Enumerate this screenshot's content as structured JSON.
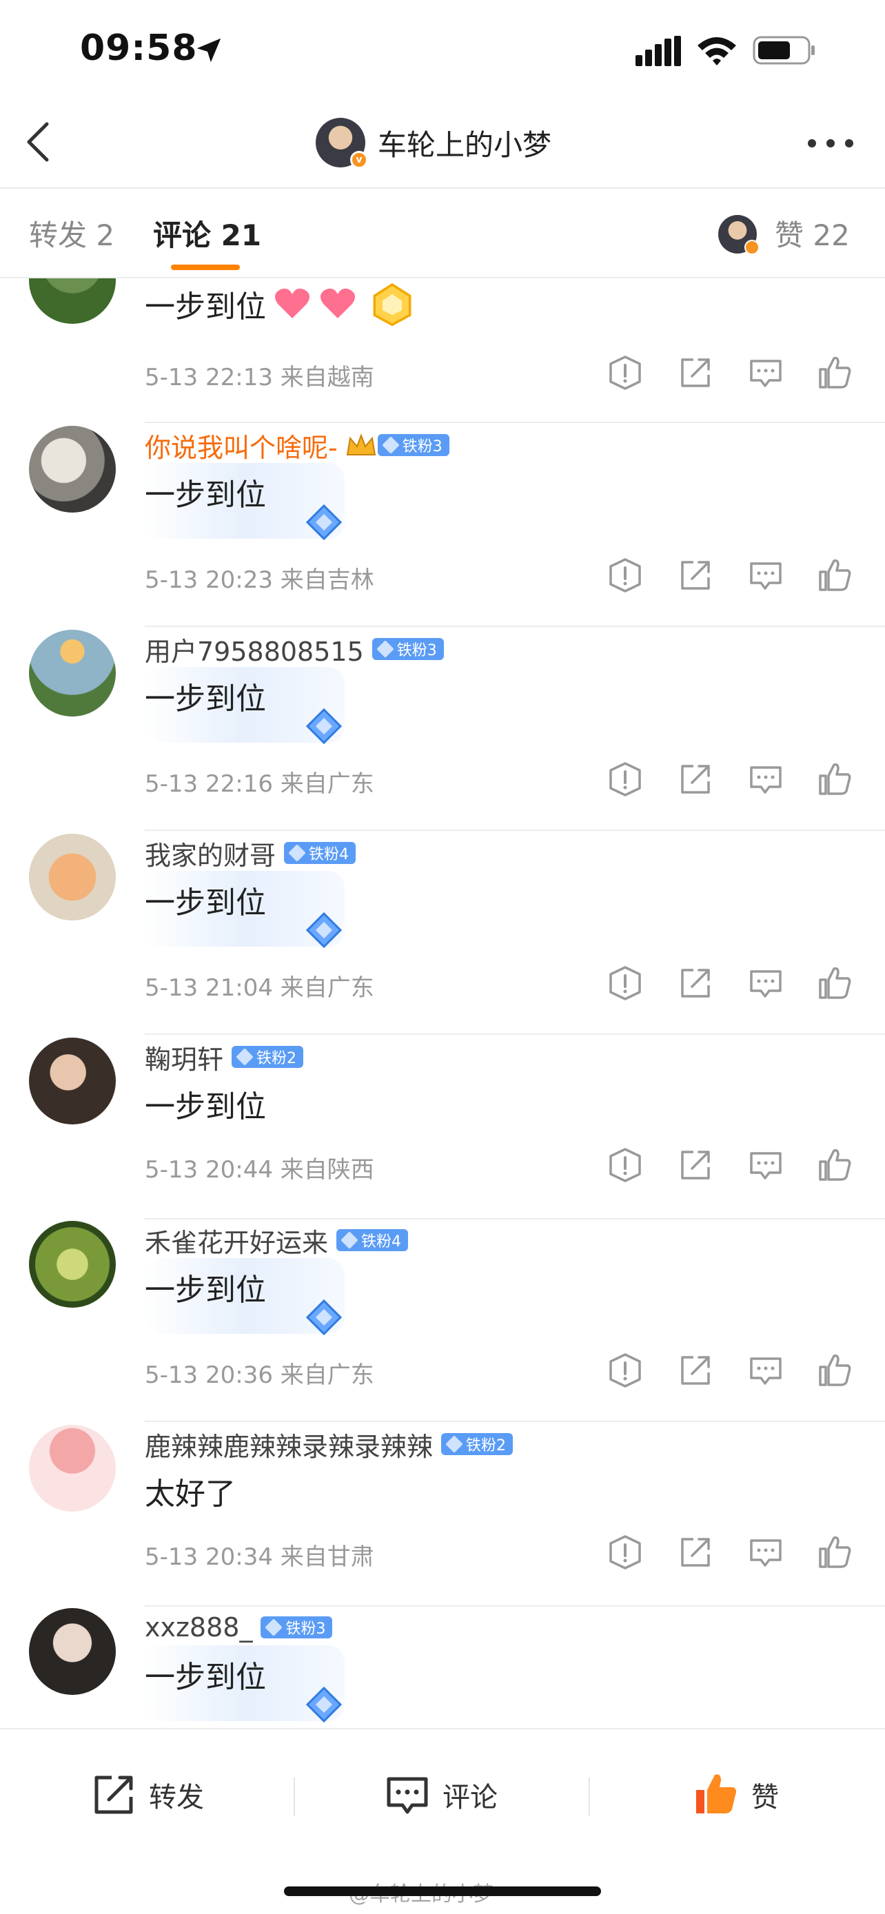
{
  "status_bar": {
    "time": "09:58"
  },
  "nav": {
    "title": "车轮上的小梦"
  },
  "tabs": {
    "repost": "转发 2",
    "comment": "评论 21",
    "like": "赞 22"
  },
  "first_partial": {
    "content": "一步到位",
    "meta": "5-13 22:13 来自越南"
  },
  "comments": [
    {
      "name": "你说我叫个啥呢-",
      "badge": "铁粉3",
      "content": "一步到位",
      "meta": "5-13 20:23 来自吉林"
    },
    {
      "name": "用户7958808515",
      "badge": "铁粉3",
      "content": "一步到位",
      "meta": "5-13 22:16 来自广东"
    },
    {
      "name": "我家的财哥",
      "badge": "铁粉4",
      "content": "一步到位",
      "meta": "5-13 21:04 来自广东"
    },
    {
      "name": "鞠玥轩",
      "badge": "铁粉2",
      "content": "一步到位",
      "meta": "5-13 20:44 来自陕西"
    },
    {
      "name": "禾雀花开好运来",
      "badge": "铁粉4",
      "content": "一步到位",
      "meta": "5-13 20:36 来自广东"
    },
    {
      "name": "鹿辣辣鹿辣辣录辣录辣辣",
      "badge": "铁粉2",
      "content": "太好了",
      "meta": "5-13 20:34 来自甘肃"
    },
    {
      "name": "xxz888_",
      "badge": "铁粉3",
      "content": "一步到位"
    }
  ],
  "bottom_bar": {
    "repost": "转发",
    "comment": "评论",
    "like": "赞"
  },
  "watermark": "@车轮上的小梦",
  "colors": {
    "accent": "#ff8200",
    "orange_name": "#f76b0b",
    "badge": "#5a9cf5"
  }
}
